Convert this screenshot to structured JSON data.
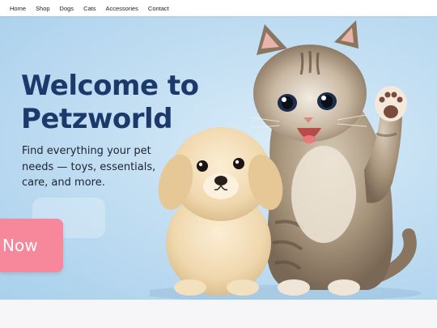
{
  "nav": {
    "items": [
      "Home",
      "Shop",
      "Dogs",
      "Cats",
      "Accessories",
      "Contact"
    ]
  },
  "hero": {
    "title": "Welcome to Petzworld",
    "subtitle": "Find everything your pet needs — toys, essentials, care, and more.",
    "cta_label": "Now",
    "image_icon": "puppy-and-kitten-illustration"
  },
  "colors": {
    "title": "#1b3a6b",
    "cta": "#f7879a",
    "hero_bg": "#c2def2"
  }
}
